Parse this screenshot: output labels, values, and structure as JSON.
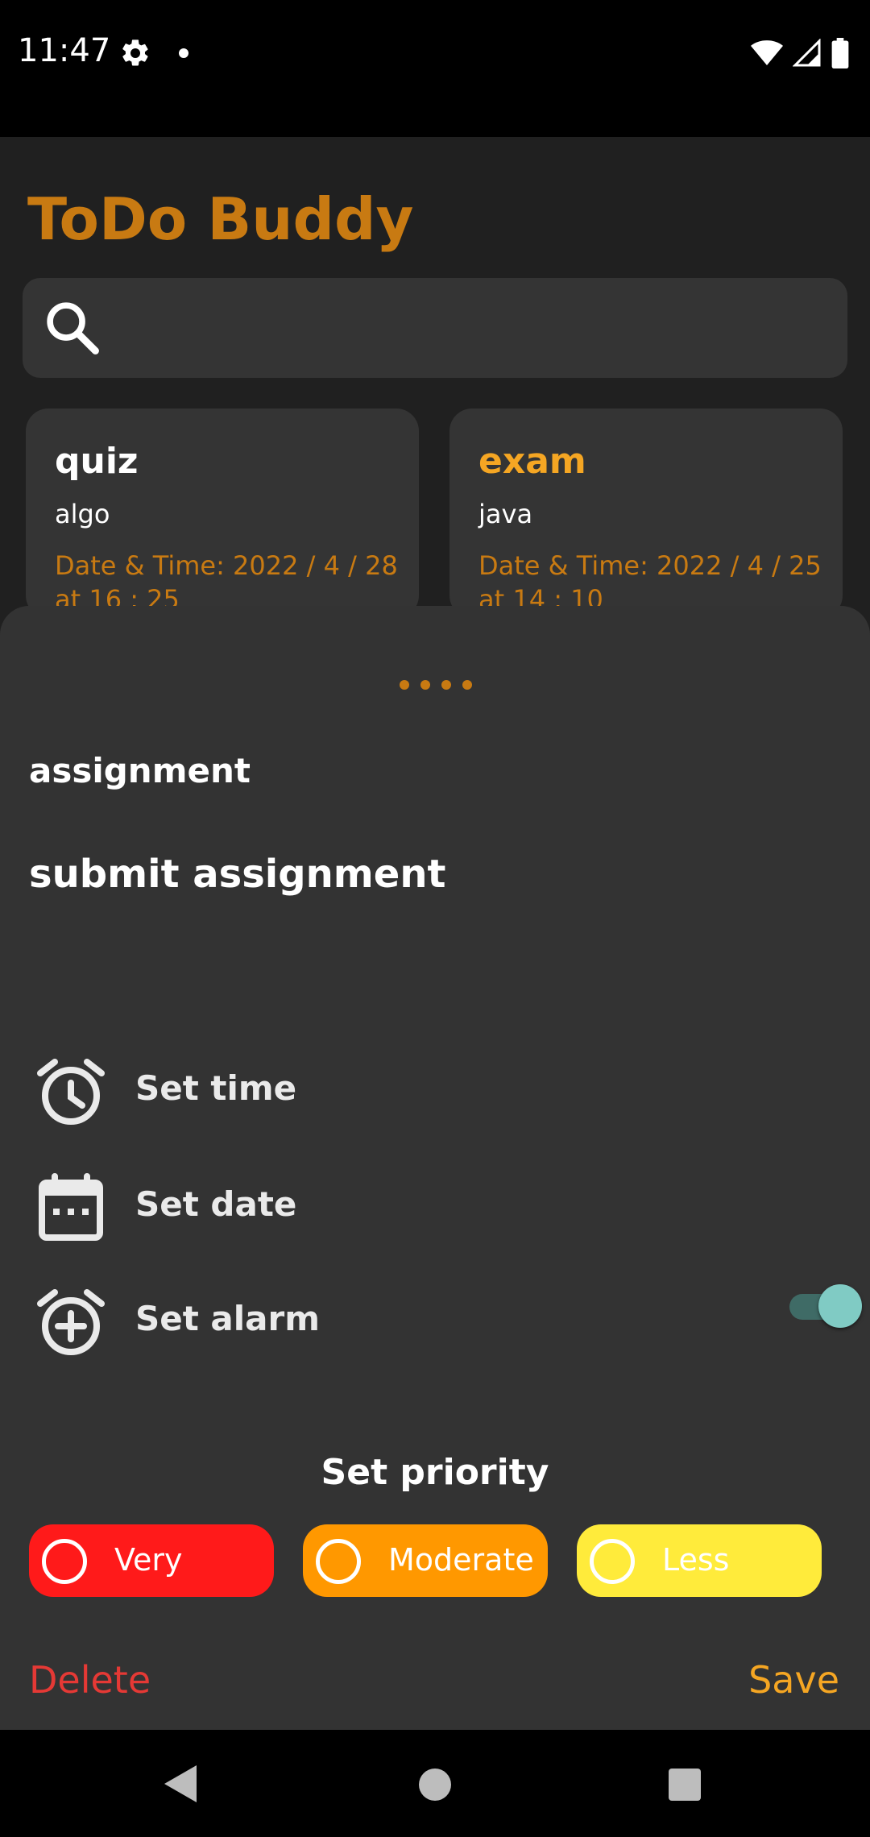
{
  "status_bar": {
    "time": "11:47",
    "icons": [
      "gear-icon",
      "dot-icon",
      "wifi-icon",
      "signal-icon",
      "battery-icon"
    ]
  },
  "app": {
    "title": "ToDo Buddy",
    "search": {
      "placeholder": "",
      "icon": "search-icon"
    }
  },
  "cards": [
    {
      "title": "quiz",
      "subtitle": "algo",
      "datetime": "Date & Time:  2022 / 4 / 28  at  16 : 25",
      "title_color": "#ffffff"
    },
    {
      "title": "exam",
      "subtitle": "java",
      "datetime": "Date & Time:  2022 / 4 / 25  at  14 : 10",
      "title_color": "#f5a623"
    }
  ],
  "sheet": {
    "title": "assignment",
    "description": "submit assignment",
    "rows": [
      {
        "label": "Set time",
        "icon": "alarm-clock-icon"
      },
      {
        "label": "Set date",
        "icon": "calendar-icon"
      },
      {
        "label": "Set alarm",
        "icon": "alarm-add-icon"
      }
    ],
    "alarm_enabled": true,
    "priority": {
      "title": "Set priority",
      "options": [
        {
          "label": "Very",
          "color": "#ff1a1a"
        },
        {
          "label": "Moderate",
          "color": "#ff9800"
        },
        {
          "label": "Less",
          "color": "#ffeb3b"
        }
      ]
    },
    "delete_label": "Delete",
    "save_label": "Save"
  },
  "colors": {
    "accent": "#c87a12",
    "save": "#f5a623",
    "delete": "#e53935",
    "toggle": "#80cbc4"
  }
}
